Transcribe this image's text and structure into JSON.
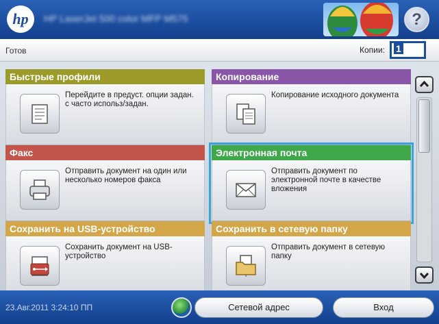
{
  "header": {
    "logo_text": "hp",
    "printer_name": "HP LaserJet 500 color MFP M575",
    "help_label": "?"
  },
  "status": {
    "text": "Готов",
    "copies_label": "Копии:",
    "copies_value": "1"
  },
  "tiles": [
    {
      "title": "Быстрые профили",
      "desc": "Перейдите в предуст. опции задан. с часто использ/задан.",
      "icon": "quick-sets-icon",
      "color": "#9c9b2a"
    },
    {
      "title": "Копирование",
      "desc": "Копирование исходного документа",
      "icon": "copy-icon",
      "color": "#8a56a8"
    },
    {
      "title": "Факс",
      "desc": "Отправить документ на один или несколько номеров факса",
      "icon": "fax-icon",
      "color": "#c4554a"
    },
    {
      "title": "Электронная почта",
      "desc": "Отправить документ по электронной почте в качестве вложения",
      "icon": "email-icon",
      "color": "#3fa84a"
    },
    {
      "title": "Сохранить на USB-устройство",
      "desc": "Сохранить документ на USB-устройство",
      "icon": "usb-icon",
      "color": "#d4a64a"
    },
    {
      "title": "Сохранить в сетевую папку",
      "desc": "Отправить документ в сетевую папку",
      "icon": "network-folder-icon",
      "color": "#d4a64a"
    }
  ],
  "footer": {
    "datetime": "23.Авг.2011 3:24:10 ПП",
    "network_address_label": "Сетевой адрес",
    "login_label": "Вход"
  }
}
